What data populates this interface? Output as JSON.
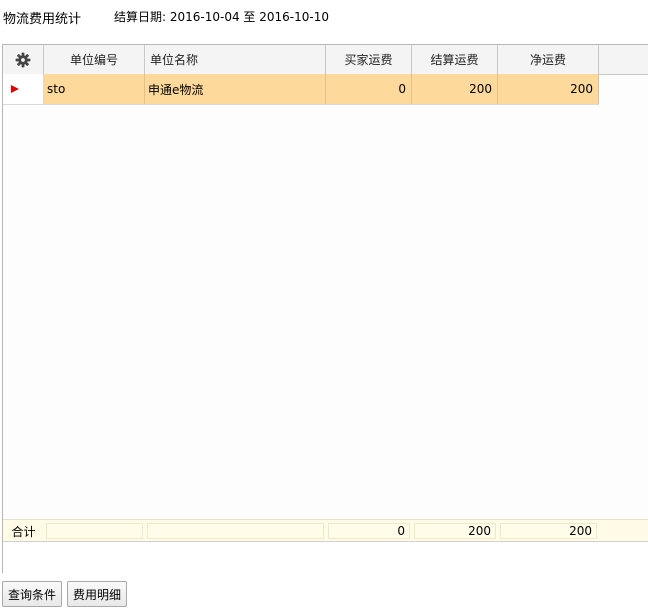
{
  "header": {
    "title": "物流费用统计",
    "date_range": "结算日期: 2016-10-04 至 2016-10-10"
  },
  "grid": {
    "settings_icon": "gear-icon",
    "columns": [
      "单位编号",
      "单位名称",
      "买家运费",
      "结算运费",
      "净运费"
    ],
    "rows": [
      {
        "code": "sto",
        "name": "申通e物流",
        "buyer_freight": "0",
        "settlement_freight": "200",
        "net_freight": "200"
      }
    ],
    "footer": {
      "label": "合计",
      "code": "",
      "name": "",
      "buyer_freight": "0",
      "settlement_freight": "200",
      "net_freight": "200"
    },
    "selected_row_color": "#fdd99b",
    "row_indicator_color": "#e00000"
  },
  "buttons": {
    "query": "查询条件",
    "detail": "费用明细"
  }
}
